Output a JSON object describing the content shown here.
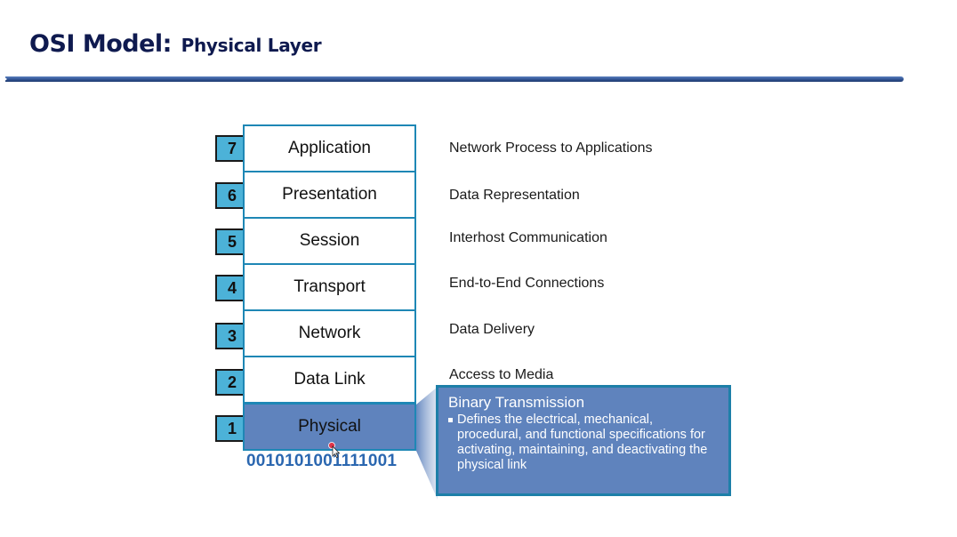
{
  "slide": {
    "title_main": "OSI Model:",
    "title_sub": "Physical Layer"
  },
  "layers": [
    {
      "number": "7",
      "name": "Application",
      "description": "Network Process to Applications"
    },
    {
      "number": "6",
      "name": "Presentation",
      "description": "Data Representation"
    },
    {
      "number": "5",
      "name": "Session",
      "description": "Interhost Communication"
    },
    {
      "number": "4",
      "name": "Transport",
      "description": "End-to-End Connections"
    },
    {
      "number": "3",
      "name": "Network",
      "description": "Data Delivery"
    },
    {
      "number": "2",
      "name": "Data Link",
      "description": "Access to Media"
    },
    {
      "number": "1",
      "name": "Physical",
      "description": ""
    }
  ],
  "highlighted_layer": "Physical",
  "binary_stream": "0010101001111001",
  "callout": {
    "heading": "Binary Transmission",
    "bullet": "Defines the electrical, mechanical, procedural, and functional specifications for activating, maintaining, and deactivating the physical link"
  },
  "colors": {
    "title": "#0f1a4f",
    "badge": "#4cb2d8",
    "layer_border": "#1e87b5",
    "highlight": "#5f83bd",
    "binary_text": "#2b67b0"
  }
}
